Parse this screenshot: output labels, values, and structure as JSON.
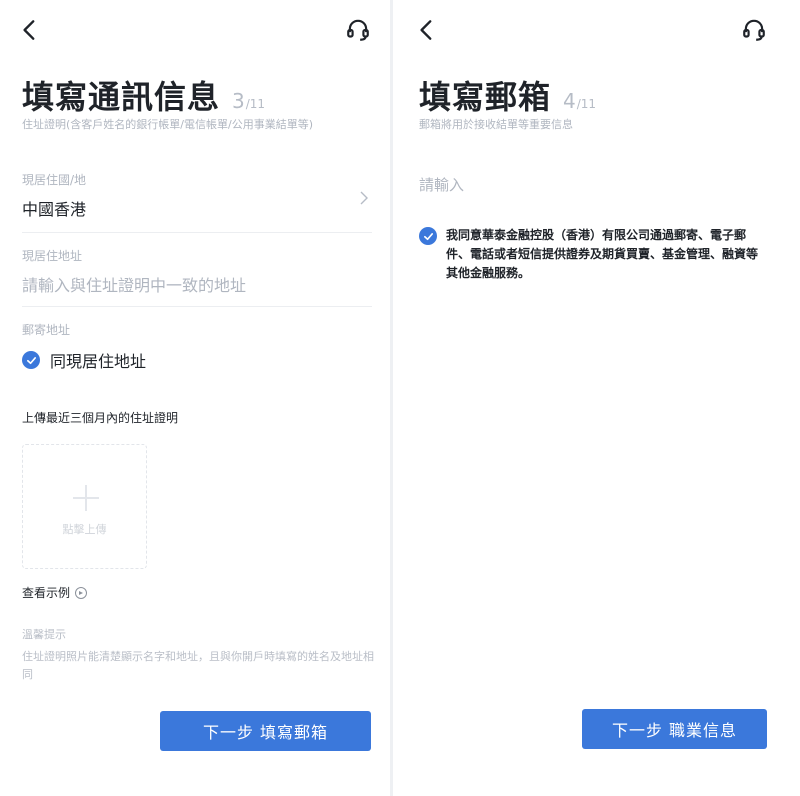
{
  "left": {
    "title": "填寫通訊信息",
    "step_current": "3",
    "step_total": "/11",
    "subtitle": "住址證明(含客戶姓名的銀行帳單/電信帳單/公用事業結單等)",
    "residence_region": {
      "label": "現居住國/地",
      "value": "中國香港"
    },
    "residential_address": {
      "label": "現居住地址",
      "placeholder": "請輸入與住址證明中一致的地址"
    },
    "mailing_address": {
      "label": "郵寄地址",
      "same_as_label": "同現居住地址",
      "checked": true
    },
    "upload_section_title": "上傳最近三個月內的住址證明",
    "upload_label": "點擊上傳",
    "example_link": "查看示例",
    "tips_title": "溫馨提示",
    "tips_text": "住址證明照片能清楚顯示名字和地址，且與你開戶時填寫的姓名及地址相同",
    "next_button": "下一步  填寫郵箱"
  },
  "right": {
    "title": "填寫郵箱",
    "step_current": "4",
    "step_total": "/11",
    "subtitle": "郵箱將用於接收結單等重要信息",
    "email_placeholder": "請輸入",
    "consent_text": "我同意華泰金融控股（香港）有限公司通過郵寄、電子郵件、電話或者短信提供證券及期貨買賣、基金管理、融資等其他金融服務。",
    "consent_checked": true,
    "next_button": "下一步  職業信息"
  },
  "colors": {
    "accent": "#3b78db",
    "muted_text": "#b0b6c0",
    "primary_text": "#1f2329"
  },
  "icons": [
    "back-arrow-icon",
    "headset-icon",
    "chevron-right-icon",
    "checkmark-icon",
    "plus-icon",
    "play-circle-icon"
  ]
}
